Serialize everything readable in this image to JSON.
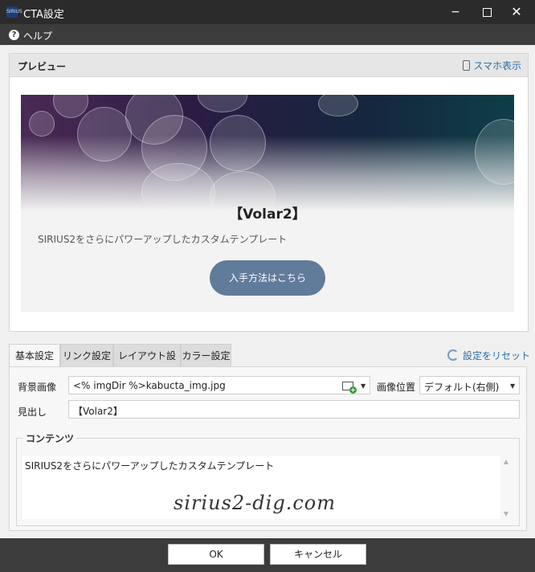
{
  "window": {
    "app_icon_text": "SIRIUS",
    "title": "CTA設定",
    "minimize_glyph": "−",
    "close_glyph": "✕"
  },
  "help": {
    "icon": "question-circle-icon",
    "label": "ヘルプ"
  },
  "preview": {
    "title": "プレビュー",
    "mobile_label": "スマホ表示",
    "mobile_icon": "smartphone-icon",
    "cta": {
      "heading": "【Volar2】",
      "description": "SIRIUS2をさらにパワーアップしたカスタムテンプレート",
      "button": "入手方法はこちら",
      "button_color": "#617b9b"
    }
  },
  "tabs": [
    {
      "label": "基本設定",
      "active": true
    },
    {
      "label": "リンク設定",
      "active": false
    },
    {
      "label": "レイアウト設定",
      "active": false
    },
    {
      "label": "カラー設定",
      "active": false
    }
  ],
  "reset_label": "設定をリセット",
  "form": {
    "bg_image_label": "背景画像",
    "bg_image_value": "<% imgDir %>kabucta_img.jpg",
    "image_position_label": "画像位置",
    "image_position_value": "デフォルト(右側)",
    "heading_label": "見出し",
    "heading_value": "【Volar2】",
    "contents_label": "コンテンツ",
    "contents_value": "SIRIUS2をさらにパワーアップしたカスタムテンプレート"
  },
  "watermark": "sirius2-dig.com",
  "footer": {
    "ok": "OK",
    "cancel": "キャンセル"
  },
  "colors": {
    "link": "#2a6ea6",
    "titlebar": "#2b2b2b",
    "toolbar": "#3c3c3c"
  }
}
